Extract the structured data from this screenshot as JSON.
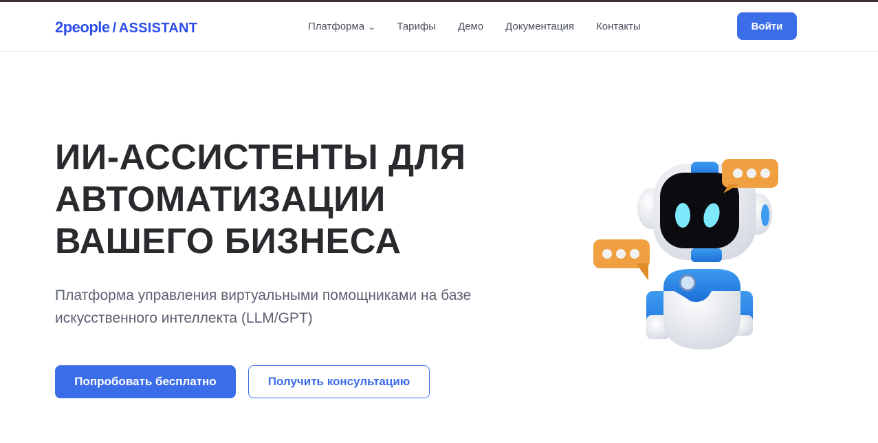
{
  "header": {
    "logo_brand": "2people",
    "logo_sep": "/",
    "logo_product": "ASSISTANT",
    "nav": [
      {
        "label": "Платформа"
      },
      {
        "label": "Тарифы"
      },
      {
        "label": "Демо"
      },
      {
        "label": "Документация"
      },
      {
        "label": "Контакты"
      }
    ],
    "login_label": "Войти"
  },
  "hero": {
    "title_lines": [
      "ИИ-АССИСТЕНТЫ ДЛЯ",
      "АВТОМАТИЗАЦИИ",
      "ВАШЕГО БИЗНЕСА"
    ],
    "subtitle_lines": [
      "Платформа управления виртуальными помощниками на базе",
      "искусственного интеллекта (LLM/GPT)"
    ],
    "primary_button": "Попробовать бесплатно",
    "secondary_button": "Получить консультацию"
  },
  "colors": {
    "brand": "#2b4ee8",
    "accent": "#3c6de8",
    "bubble": "#f0a040"
  }
}
